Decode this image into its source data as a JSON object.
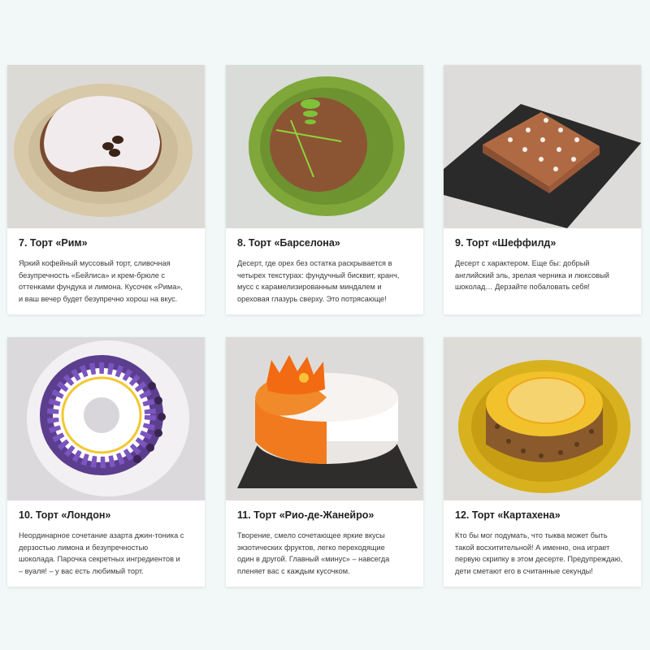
{
  "cards": [
    {
      "title": "7. Торт «Рим»",
      "lines": [
        "Яркий кофейный муссовый торт, сливочная",
        "безупречность «Бейлиса» и крем-брюле с",
        "оттенками фундука и лимона. Кусочек «Рима»,",
        "и ваш вечер будет безупречно хорош на вкус."
      ]
    },
    {
      "title": "8. Торт «Барселона»",
      "lines": [
        "Десерт, где орех без остатка раскрывается в",
        "четырех текстурах: фундучный бисквит, кранч,",
        "мусс с карамелизированным миндалем и",
        "ореховая глазурь сверху. Это потрясающе!"
      ]
    },
    {
      "title": "9. Торт «Шеффилд»",
      "lines": [
        "Десерт с характером. Еще бы: добрый",
        "английский эль, зрелая черника и люксовый",
        "шоколад… Дерзайте побаловать себя!"
      ]
    },
    {
      "title": "10. Торт «Лондон»",
      "lines": [
        "Неординарное сочетание азарта джин-тоника с",
        "дерзостью лимона и безупречностью",
        "шоколада. Парочка секретных ингредиентов и",
        "– вуаля! – у вас есть любимый торт."
      ]
    },
    {
      "title": "11. Торт «Рио-де-Жанейро»",
      "lines": [
        "Творение, смело сочетающее яркие вкусы",
        "экзотических фруктов, легко переходящие",
        "один в другой. Главный «минус» – навсегда",
        "пленяет вас с каждым кусочком."
      ]
    },
    {
      "title": "12. Торт «Картахена»",
      "lines": [
        "Кто бы мог подумать, что тыква может быть",
        "такой восхитительной! А именно, она играет",
        "первую скрипку в этом десерте. Предупреждаю,",
        "дети сметают его в считанные секунды!"
      ]
    }
  ]
}
